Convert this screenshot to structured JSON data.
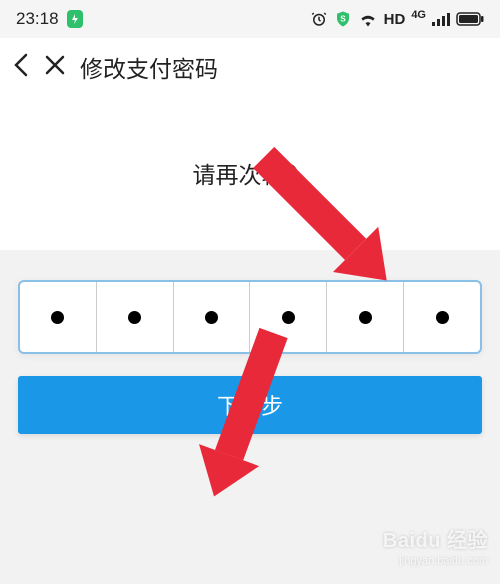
{
  "status": {
    "time": "23:18",
    "hd_label": "HD",
    "net_label": "4G"
  },
  "nav": {
    "title": "修改支付密码"
  },
  "content": {
    "prompt": "请再次输入",
    "pin_length": 6,
    "pin_filled": 6,
    "next_button": "下一步"
  },
  "watermark": {
    "brand": "Baidu 经验",
    "sub": "jingyan.baidu.com"
  }
}
